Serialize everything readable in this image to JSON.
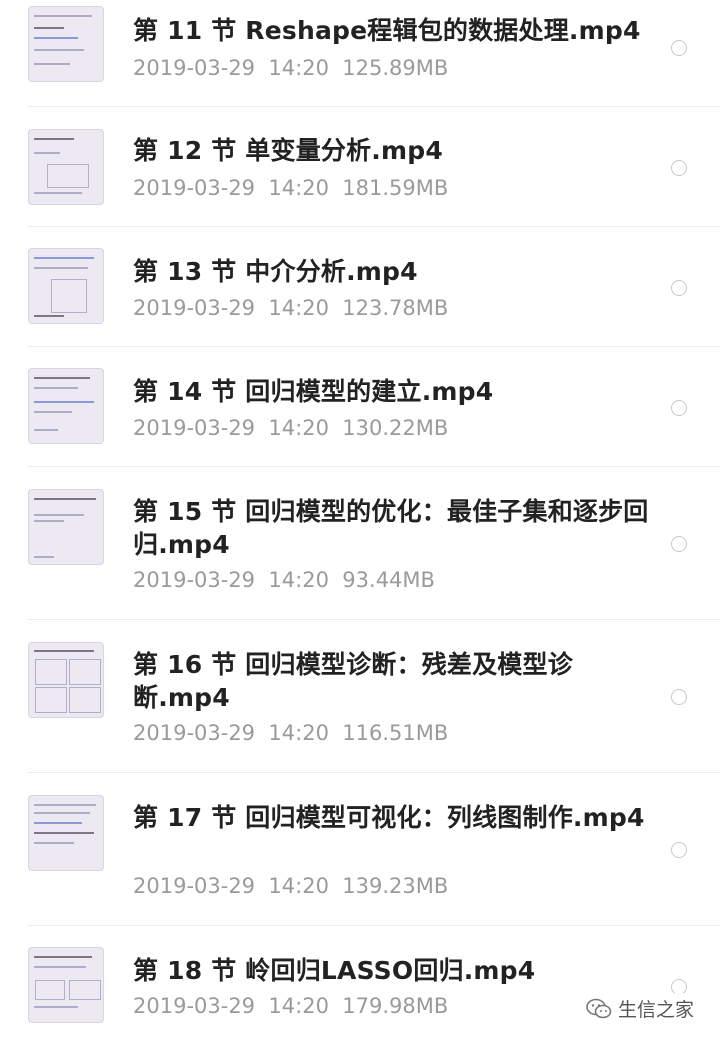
{
  "files": [
    {
      "title": "第 11 节 Reshape程辑包的数据处理.mp4",
      "date": "2019-03-29",
      "time": "14:20",
      "size": "125.89MB"
    },
    {
      "title": "第 12 节 单变量分析.mp4",
      "date": "2019-03-29",
      "time": "14:20",
      "size": "181.59MB"
    },
    {
      "title": "第 13 节 中介分析.mp4",
      "date": "2019-03-29",
      "time": "14:20",
      "size": "123.78MB"
    },
    {
      "title": "第 14 节 回归模型的建立.mp4",
      "date": "2019-03-29",
      "time": "14:20",
      "size": "130.22MB"
    },
    {
      "title": "第 15 节 回归模型的优化：最佳子集和逐步回归.mp4",
      "date": "2019-03-29",
      "time": "14:20",
      "size": "93.44MB"
    },
    {
      "title": "第 16 节 回归模型诊断：残差及模型诊断.mp4",
      "date": "2019-03-29",
      "time": "14:20",
      "size": "116.51MB"
    },
    {
      "title": "第 17 节 回归模型可视化：列线图制作.mp4",
      "date": "2019-03-29",
      "time": "14:20",
      "size": "139.23MB"
    },
    {
      "title": "第 18 节 岭回归LASSO回归.mp4",
      "date": "2019-03-29",
      "time": "14:20",
      "size": "179.98MB"
    }
  ],
  "watermark": {
    "text": "生信之家",
    "icon": "wechat-icon"
  },
  "colors": {
    "title": "#222222",
    "meta": "#9a9a9a",
    "divider": "#ececec",
    "radio_border": "#c8c8c8"
  }
}
